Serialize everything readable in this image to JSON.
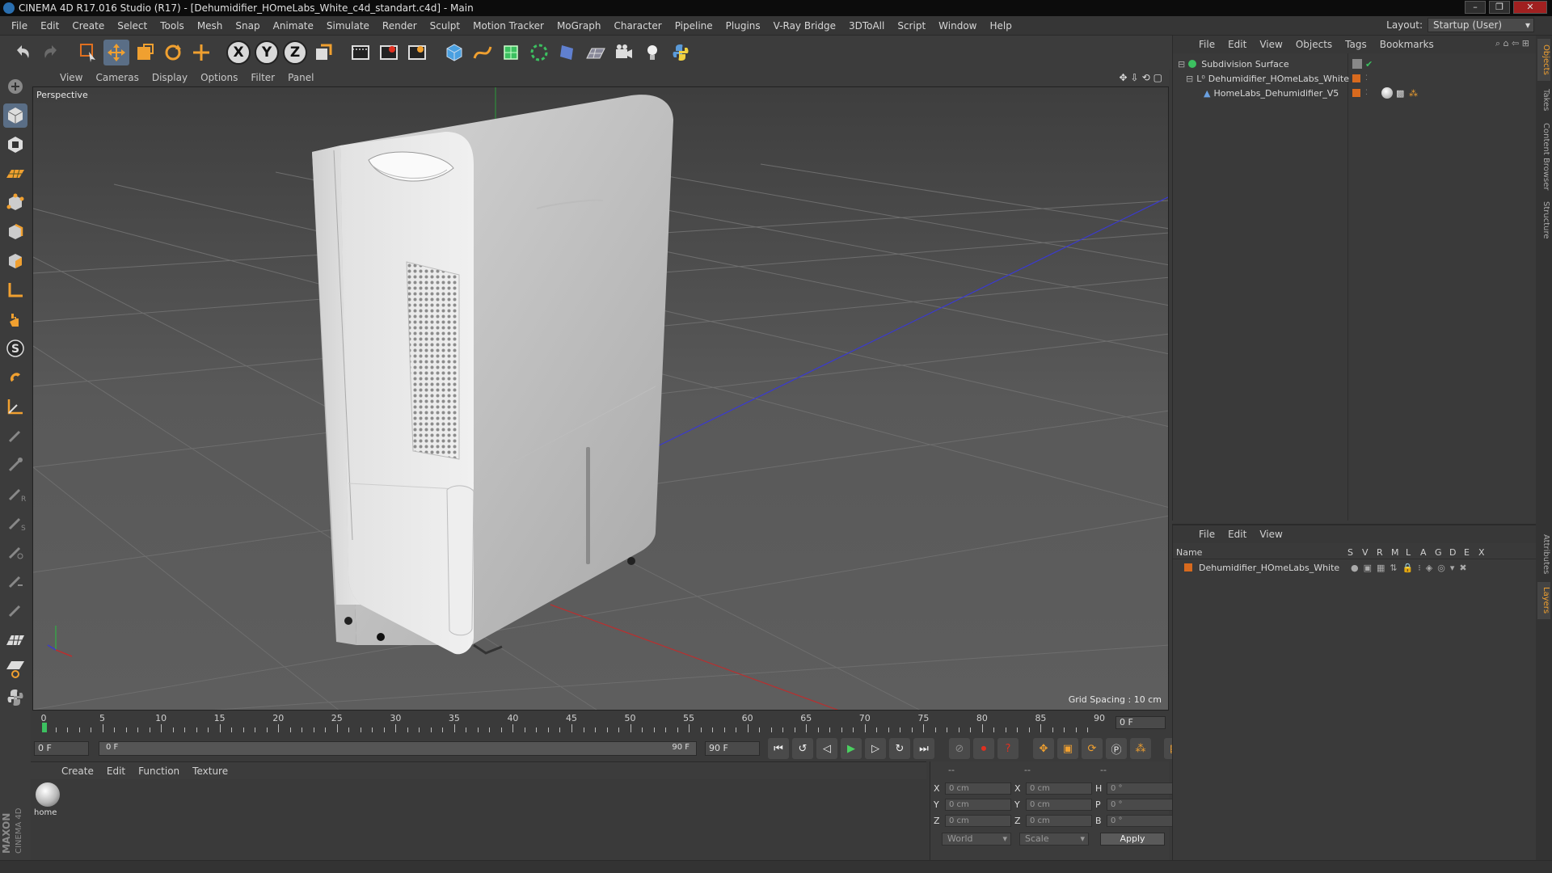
{
  "window": {
    "title": "CINEMA 4D R17.016 Studio (R17) - [Dehumidifier_HOmeLabs_White_c4d_standart.c4d] - Main"
  },
  "menubar": {
    "items": [
      "File",
      "Edit",
      "Create",
      "Select",
      "Tools",
      "Mesh",
      "Snap",
      "Animate",
      "Simulate",
      "Render",
      "Sculpt",
      "Motion Tracker",
      "MoGraph",
      "Character",
      "Pipeline",
      "Plugins",
      "V-Ray Bridge",
      "3DToAll",
      "Script",
      "Window",
      "Help"
    ],
    "layout_label": "Layout:",
    "layout_value": "Startup (User)"
  },
  "toolbar": {
    "icons": [
      "undo-icon",
      "redo-icon",
      "live-selection-icon",
      "move-icon",
      "scale-icon",
      "rotate-icon",
      "recent-tool-icon",
      "x-axis-icon",
      "y-axis-icon",
      "z-axis-icon",
      "coordinate-system-icon",
      "render-view-icon",
      "render-picture-viewer-icon",
      "edit-render-settings-icon",
      "cube-icon",
      "spline-pen-icon",
      "subdivision-surface-icon",
      "array-icon",
      "deformer-icon",
      "floor-icon",
      "camera-icon",
      "light-icon",
      "python-icon"
    ],
    "axis_x": "X",
    "axis_y": "Y",
    "axis_z": "Z"
  },
  "viewport": {
    "menu": [
      "View",
      "Cameras",
      "Display",
      "Options",
      "Filter",
      "Panel"
    ],
    "label": "Perspective",
    "grid_spacing": "Grid Spacing : 10 cm"
  },
  "timeline": {
    "ticks": [
      "0",
      "5",
      "10",
      "15",
      "20",
      "25",
      "30",
      "35",
      "40",
      "45",
      "50",
      "55",
      "60",
      "65",
      "70",
      "75",
      "80",
      "85",
      "90"
    ],
    "current_frame": "0 F",
    "start_field": "0 F",
    "range_start": "0 F",
    "range_end": "90 F",
    "end_field": "90 F"
  },
  "materials": {
    "menu": [
      "Create",
      "Edit",
      "Function",
      "Texture"
    ],
    "items": [
      {
        "name": "home"
      }
    ]
  },
  "coordinates": {
    "header": [
      "--",
      "--",
      "--"
    ],
    "rows": [
      {
        "axis": "X",
        "pos": "0 cm",
        "size_axis": "X",
        "size": "0 cm",
        "rot_axis": "H",
        "rot": "0 °"
      },
      {
        "axis": "Y",
        "pos": "0 cm",
        "size_axis": "Y",
        "size": "0 cm",
        "rot_axis": "P",
        "rot": "0 °"
      },
      {
        "axis": "Z",
        "pos": "0 cm",
        "size_axis": "Z",
        "size": "0 cm",
        "rot_axis": "B",
        "rot": "0 °"
      }
    ],
    "mode": "World",
    "size_mode": "Scale",
    "apply_label": "Apply"
  },
  "objects_panel": {
    "menu": [
      "File",
      "Edit",
      "View",
      "Objects",
      "Tags",
      "Bookmarks"
    ],
    "objects": [
      {
        "name": "Subdivision Surface",
        "indent": 0
      },
      {
        "name": "Dehumidifier_HOmeLabs_White",
        "indent": 1
      },
      {
        "name": "HomeLabs_Dehumidifier_V5",
        "indent": 2
      }
    ]
  },
  "layers_panel": {
    "menu": [
      "File",
      "Edit",
      "View"
    ],
    "columns": [
      "Name",
      "S",
      "V",
      "R",
      "M",
      "L",
      "A",
      "G",
      "D",
      "E",
      "X"
    ],
    "layers": [
      {
        "name": "Dehumidifier_HOmeLabs_White",
        "color": "#d86a1e"
      }
    ]
  },
  "side_tabs": [
    "Objects",
    "Takes",
    "Content Browser",
    "Structure",
    "Attributes",
    "Layers"
  ],
  "colors": {
    "accent_orange": "#f0a030",
    "layer_orange": "#d86a1e",
    "viewport_bg": "#5a5a5a"
  }
}
